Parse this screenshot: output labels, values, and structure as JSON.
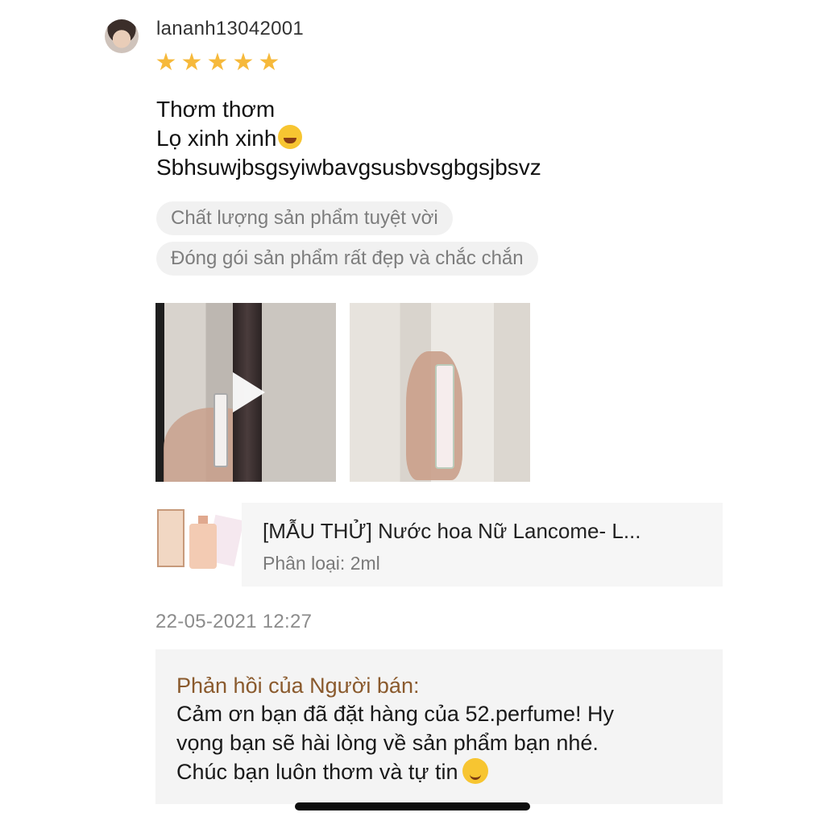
{
  "review": {
    "username": "lananh13042001",
    "rating": 5,
    "stars": [
      "★",
      "★",
      "★",
      "★",
      "★"
    ],
    "text_lines": [
      "Thơm thơm",
      "Lọ xinh xinh",
      "Sbhsuwjbsgsyiwbavgsusbvsgbgsjbsvz"
    ],
    "tags": [
      "Chất lượng sản phẩm tuyệt vời",
      "Đóng gói sản phẩm rất đẹp và chắc chắn"
    ],
    "media": [
      {
        "type": "video",
        "icon": "play-icon"
      },
      {
        "type": "image"
      }
    ]
  },
  "product": {
    "name": "[MẪU THỬ] Nước hoa Nữ Lancome- L...",
    "variant": "Phân loại: 2ml"
  },
  "timestamp": "22-05-2021 12:27",
  "seller_reply": {
    "title": "Phản hồi của Người bán:",
    "lines": [
      "Cảm ơn bạn đã đặt hàng của 52.perfume! Hy",
      "vọng bạn sẽ hài lòng về sản phẩm bạn nhé.",
      "Chúc bạn luôn thơm và tự tin"
    ]
  },
  "colors": {
    "star": "#f6b93b",
    "seller_title": "#8a5a2d",
    "tag_bg": "#f1f1f1",
    "panel_bg": "#f6f6f6"
  }
}
